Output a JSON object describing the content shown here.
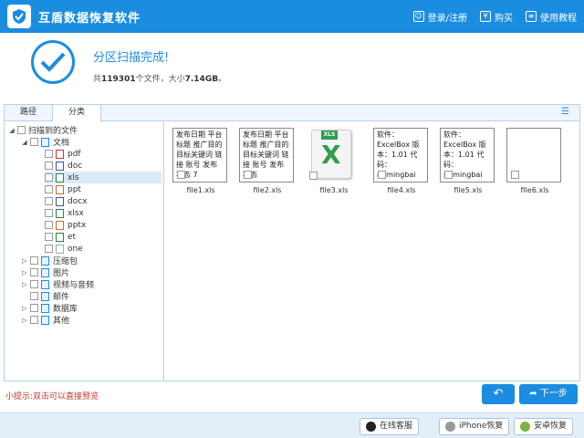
{
  "titlebar": {
    "title": "互盾数据恢复软件",
    "login": "登录/注册",
    "buy": "购买",
    "tutorial": "使用教程"
  },
  "header": {
    "title": "分区扫描完成!",
    "sub_prefix": "共",
    "file_count": "119301",
    "sub_mid": "个文件，大小",
    "size": "7.14GB",
    "sub_suffix": "。"
  },
  "tabs": {
    "path": "路径",
    "category": "分类"
  },
  "tree": {
    "root": "扫描到的文件",
    "documents": "文档",
    "types": [
      "pdf",
      "doc",
      "xls",
      "ppt",
      "docx",
      "xlsx",
      "pptx",
      "et",
      "one"
    ],
    "selected_type": "xls",
    "categories": [
      "压缩包",
      "图片",
      "视频与音频",
      "邮件",
      "数据库",
      "其他"
    ]
  },
  "files": [
    {
      "name": "file1.xls",
      "preview": "发布日期 平台标题 推广目的 目标关键词 链接 账号 发布状态 7"
    },
    {
      "name": "file2.xls",
      "preview": "发布日期 平台标题 推广目的 目标关键词 链接 账号 发布状态"
    },
    {
      "name": "file3.xls",
      "preview": ""
    },
    {
      "name": "file4.xls",
      "preview": "软件：ExcelBox 版本：1.01 代码：ngmingbai"
    },
    {
      "name": "file5.xls",
      "preview": "软件：ExcelBox 版本：1.01 代码：ngmingbai"
    },
    {
      "name": "file6.xls",
      "preview": ""
    }
  ],
  "xls_badge": "XLS",
  "hint": "小提示:双击可以直接预览",
  "buttons": {
    "next": "下一步"
  },
  "footer": {
    "service": "在线客服",
    "iphone": "iPhone恢复",
    "android": "安卓恢复"
  },
  "colors": {
    "brand": "#1b8de0",
    "hint": "#c0392b",
    "excel": "#2e9e4f"
  },
  "icons": [
    "shield-logo-icon",
    "user-icon",
    "yen-icon",
    "book-icon",
    "check-icon",
    "list-view-icon",
    "back-arrow-icon",
    "next-arrow-icon",
    "headset-icon",
    "apple-icon",
    "android-icon"
  ]
}
